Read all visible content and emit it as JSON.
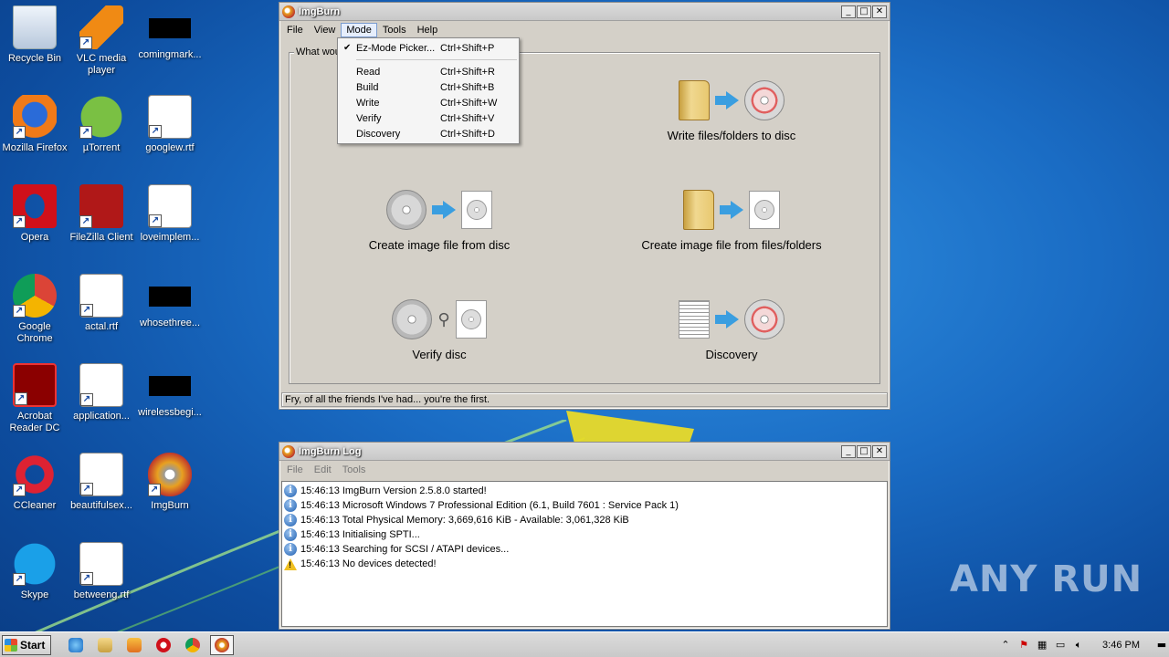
{
  "desktop": {
    "icons": [
      {
        "label": "Recycle Bin"
      },
      {
        "label": "VLC media player"
      },
      {
        "label": "comingmark..."
      },
      {
        "label": "Mozilla Firefox"
      },
      {
        "label": "µTorrent"
      },
      {
        "label": "googlew.rtf"
      },
      {
        "label": "Opera"
      },
      {
        "label": "FileZilla Client"
      },
      {
        "label": "loveimplem..."
      },
      {
        "label": "Google Chrome"
      },
      {
        "label": "actal.rtf"
      },
      {
        "label": "whosethree..."
      },
      {
        "label": "Acrobat Reader DC"
      },
      {
        "label": "application..."
      },
      {
        "label": "wirelessbegi..."
      },
      {
        "label": "CCleaner"
      },
      {
        "label": "beautifulsex..."
      },
      {
        "label": "ImgBurn"
      },
      {
        "label": "Skype"
      },
      {
        "label": "betweeng.rtf"
      }
    ]
  },
  "imgburn": {
    "title": "ImgBurn",
    "menu": [
      "File",
      "View",
      "Mode",
      "Tools",
      "Help"
    ],
    "group_label": "What wou",
    "tiles": {
      "write_files": "Write files/folders to disc",
      "create_from_disc": "Create image file from disc",
      "create_from_files": "Create image file from files/folders",
      "verify": "Verify disc",
      "discovery": "Discovery"
    },
    "status": "Fry, of all the friends I've had... you're the first."
  },
  "mode_menu": {
    "items": [
      {
        "label": "Ez-Mode Picker...",
        "shortcut": "Ctrl+Shift+P",
        "checked": true
      },
      {
        "label": "Read",
        "shortcut": "Ctrl+Shift+R"
      },
      {
        "label": "Build",
        "shortcut": "Ctrl+Shift+B"
      },
      {
        "label": "Write",
        "shortcut": "Ctrl+Shift+W"
      },
      {
        "label": "Verify",
        "shortcut": "Ctrl+Shift+V"
      },
      {
        "label": "Discovery",
        "shortcut": "Ctrl+Shift+D"
      }
    ]
  },
  "log": {
    "title": "ImgBurn Log",
    "menu": [
      "File",
      "Edit",
      "Tools"
    ],
    "lines": [
      {
        "type": "info",
        "text": "15:46:13 ImgBurn Version 2.5.8.0 started!"
      },
      {
        "type": "info",
        "text": "15:46:13 Microsoft Windows 7 Professional Edition (6.1, Build 7601 : Service Pack 1)"
      },
      {
        "type": "info",
        "text": "15:46:13 Total Physical Memory: 3,669,616 KiB  -  Available: 3,061,328 KiB"
      },
      {
        "type": "info",
        "text": "15:46:13 Initialising SPTI..."
      },
      {
        "type": "info",
        "text": "15:46:13 Searching for SCSI / ATAPI devices..."
      },
      {
        "type": "warn",
        "text": "15:46:13 No devices detected!"
      }
    ]
  },
  "taskbar": {
    "start_label": "Start",
    "clock": "3:46 PM"
  },
  "watermark": "ANY RUN",
  "colors": {
    "desktop_blue": "#1a6cc4",
    "window_face": "#d4d0c8",
    "accent_arrow": "#3a9ee0"
  }
}
